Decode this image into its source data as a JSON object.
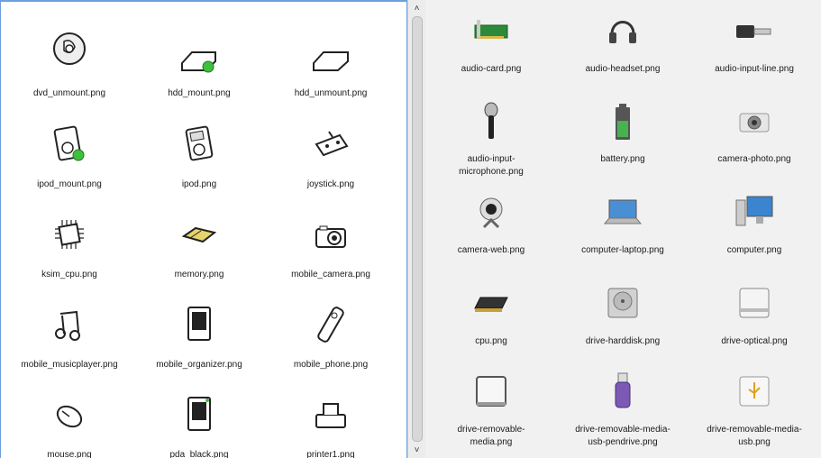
{
  "left_panel": {
    "items": [
      {
        "name": "dvd_unmount.png",
        "icon": "dvd-unmount-icon"
      },
      {
        "name": "hdd_mount.png",
        "icon": "hdd-mount-icon"
      },
      {
        "name": "hdd_unmount.png",
        "icon": "hdd-unmount-icon"
      },
      {
        "name": "ipod_mount.png",
        "icon": "ipod-mount-icon"
      },
      {
        "name": "ipod.png",
        "icon": "ipod-icon"
      },
      {
        "name": "joystick.png",
        "icon": "joystick-icon"
      },
      {
        "name": "ksim_cpu.png",
        "icon": "ksim-cpu-icon"
      },
      {
        "name": "memory.png",
        "icon": "memory-icon"
      },
      {
        "name": "mobile_camera.png",
        "icon": "mobile-camera-icon"
      },
      {
        "name": "mobile_musicplayer.png",
        "icon": "mobile-musicplayer-icon"
      },
      {
        "name": "mobile_organizer.png",
        "icon": "mobile-organizer-icon"
      },
      {
        "name": "mobile_phone.png",
        "icon": "mobile-phone-icon"
      },
      {
        "name": "mouse.png",
        "icon": "mouse-icon"
      },
      {
        "name": "pda_black.png",
        "icon": "pda-black-icon"
      },
      {
        "name": "printer1.png",
        "icon": "printer-icon"
      }
    ]
  },
  "scrollbar": {
    "up": "˄",
    "down": "˅"
  },
  "right_panel": {
    "items": [
      {
        "line1": "audio-card.png",
        "line2": "",
        "icon": "audio-card-icon"
      },
      {
        "line1": "audio-headset.png",
        "line2": "",
        "icon": "audio-headset-icon"
      },
      {
        "line1": "audio-input-line.png",
        "line2": "",
        "icon": "audio-input-line-icon"
      },
      {
        "line1": "audio-input-",
        "line2": "microphone.png",
        "icon": "microphone-icon"
      },
      {
        "line1": "battery.png",
        "line2": "",
        "icon": "battery-icon"
      },
      {
        "line1": "camera-photo.png",
        "line2": "",
        "icon": "camera-photo-icon"
      },
      {
        "line1": "camera-web.png",
        "line2": "",
        "icon": "camera-web-icon"
      },
      {
        "line1": "computer-laptop.png",
        "line2": "",
        "icon": "laptop-icon"
      },
      {
        "line1": "computer.png",
        "line2": "",
        "icon": "computer-icon"
      },
      {
        "line1": "cpu.png",
        "line2": "",
        "icon": "cpu-icon"
      },
      {
        "line1": "drive-harddisk.png",
        "line2": "",
        "icon": "harddisk-icon"
      },
      {
        "line1": "drive-optical.png",
        "line2": "",
        "icon": "drive-optical-icon"
      },
      {
        "line1": "drive-removable-",
        "line2": "media.png",
        "icon": "drive-removable-icon"
      },
      {
        "line1": "drive-removable-media-",
        "line2": "usb-pendrive.png",
        "icon": "usb-pendrive-icon"
      },
      {
        "line1": "drive-removable-media-",
        "line2": "usb.png",
        "icon": "drive-usb-icon"
      }
    ]
  },
  "colors": {
    "accent": "#6c9ee0",
    "mount_dot": "#3fbf3f",
    "right_bg": "#f1f1f1"
  }
}
